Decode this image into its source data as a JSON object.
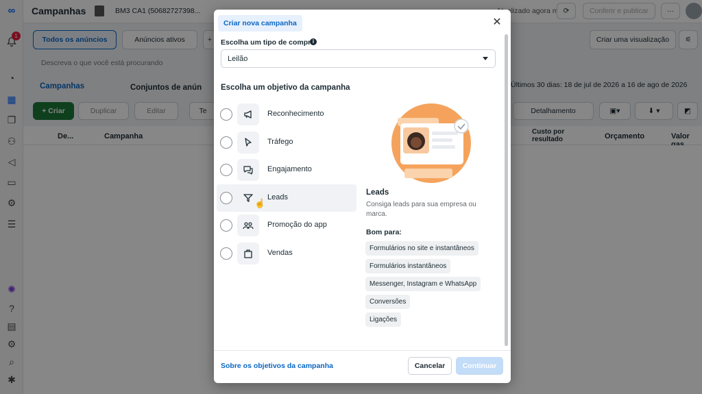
{
  "app": {
    "page_title": "Campanhas",
    "account": "BM3 CA1 (50682727398...",
    "status": "Atualizado agora mesmo",
    "review_button": "Conferir e publicar",
    "notif_count": "1",
    "search_placeholder": "Descreva o que você está procurando",
    "view_all_ads": "Todos os anúncios",
    "view_active_ads": "Anúncios ativos",
    "create_view": "Criar uma visualização",
    "tab_campaigns": "Campanhas",
    "tab_adsets": "Conjuntos de anún",
    "date_range": "Últimos 30 dias: 18 de jul de 2026 a 16 de ago de 2026",
    "create_button": "+ Criar",
    "duplicate_button": "Duplicar",
    "edit_button": "Editar",
    "test_button": "Te",
    "breakdown_button": "Detalhamento",
    "columns": {
      "delivery": "De...",
      "campaign": "Campanha",
      "cost_per_result": "Custo por resultado",
      "budget": "Orçamento",
      "amount_spent": "Valor gas"
    }
  },
  "modal": {
    "title": "Criar nova campanha",
    "buy_type_label": "Escolha um tipo de compra",
    "buy_type_value": "Leilão",
    "objective_heading": "Escolha um objetivo da campanha",
    "objectives": [
      {
        "label": "Reconhecimento",
        "icon": "megaphone-icon"
      },
      {
        "label": "Tráfego",
        "icon": "cursor-icon"
      },
      {
        "label": "Engajamento",
        "icon": "chat-icon"
      },
      {
        "label": "Leads",
        "icon": "filter-icon"
      },
      {
        "label": "Promoção do app",
        "icon": "people-icon"
      },
      {
        "label": "Vendas",
        "icon": "bag-icon"
      }
    ],
    "detail": {
      "title": "Leads",
      "description": "Consiga leads para sua empresa ou marca.",
      "good_for_label": "Bom para:",
      "good_for": [
        "Formulários no site e instantâneos",
        "Formulários instantâneos",
        "Messenger, Instagram e WhatsApp",
        "Conversões",
        "Ligações"
      ]
    },
    "about_link": "Sobre os objetivos da campanha",
    "cancel_button": "Cancelar",
    "continue_button": "Continuar"
  },
  "colors": {
    "accent": "#0a66c2",
    "create_green": "#1d7a3a",
    "illustration_orange": "#f5a35c"
  }
}
